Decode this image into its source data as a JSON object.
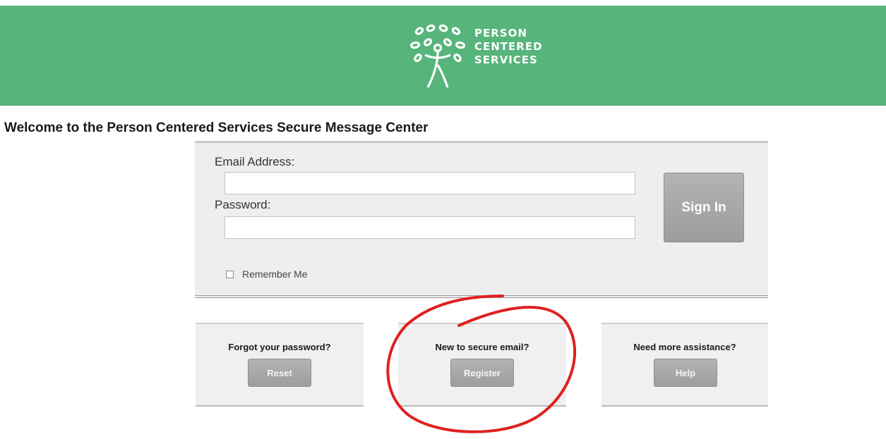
{
  "header": {
    "logo_lines": [
      "PERSON",
      "CENTERED",
      "SERVICES"
    ],
    "background_color": "#57b47b"
  },
  "page": {
    "welcome": "Welcome to the Person Centered Services Secure Message Center"
  },
  "login": {
    "email_label": "Email Address:",
    "email_value": "",
    "password_label": "Password:",
    "password_value": "",
    "signin_label": "Sign In",
    "remember_label": "Remember Me",
    "remember_checked": false
  },
  "cards": [
    {
      "title": "Forgot your password?",
      "button": "Reset"
    },
    {
      "title": "New to secure email?",
      "button": "Register"
    },
    {
      "title": "Need more assistance?",
      "button": "Help"
    }
  ],
  "annotation": {
    "shape": "circle",
    "color": "#e02020",
    "target": "Register"
  }
}
